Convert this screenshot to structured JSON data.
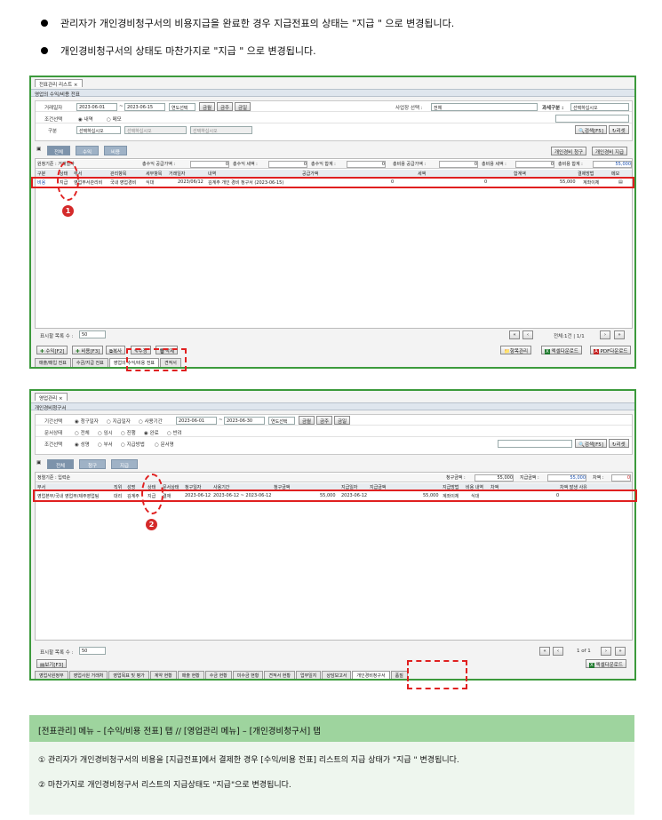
{
  "bullets": [
    "관리자가 개인경비청구서의 비용지급을 완료한 경우 지급전표의 상태는 \"지급 \" 으로 변경됩니다.",
    "개인경비청구서의 상태도 마찬가지로 \"지급 \" 으로 변경됩니다."
  ],
  "shot1": {
    "window_tab": "전표관리 리스트",
    "subtitle": "영업의 수익/비용 전표",
    "trade_date_label": "거래일자",
    "date_from": "2023-06-01",
    "date_to": "2023-06-15",
    "year_select": "연도선택",
    "quick_btns": [
      "금월",
      "금주",
      "금일"
    ],
    "biz_label": "사업장 선택 :",
    "biz_value": "전체",
    "tax_label": "과세구분 :",
    "tax_value": "선택하십시오",
    "cond_label": "조건선택",
    "cond_radio": [
      "내역",
      "메모"
    ],
    "kind_label": "구분",
    "kind_values": [
      "선택하십시오",
      "선택하십시오",
      "선택하십시오"
    ],
    "search_btn": "검색[F5]",
    "reset_btn": "리셋",
    "tabs": [
      "전체",
      "수익",
      "비용"
    ],
    "right_btns": [
      "개인경비 청구",
      "개인경비 지급"
    ],
    "summary": {
      "base": "원청기준 : 거래일자",
      "income_supply": "총수익 공급가액 :",
      "income_supply_val": "0",
      "income_tax": "총수익 세액 :",
      "income_tax_val": "0",
      "income_total": "총수익 합계 :",
      "income_total_val": "0",
      "cost_supply": "총비용 공급가액 :",
      "cost_supply_val": "0",
      "cost_tax": "총비용 세액 :",
      "cost_tax_val": "0",
      "cost_total": "총비용 합계 :",
      "cost_total_val": "55,000"
    },
    "columns": [
      "구분",
      "상태",
      "부서",
      "관리항목",
      "세부항목",
      "거래일자",
      "내역",
      "공급가액",
      "세액",
      "합계액",
      "결제방법",
      "메모"
    ],
    "row": [
      "비용",
      "지급",
      "영업부서관리비",
      "국내 영업경비",
      "식대",
      "2023/06/12",
      "김계주 개인 경비 청구서 (2023-06-15)",
      "",
      "0",
      "0",
      "55,000",
      "계좌이체"
    ],
    "page_size_label": "표시할 목록 수 :",
    "page_size": "50",
    "page_info": "전체:1건 | 1/1",
    "bottom_btns": [
      "수익[F2]",
      "비용[F3]",
      "복사",
      "수정",
      "삭제"
    ],
    "bottom_right": [
      "항목관리",
      "엑셀다운로드",
      "PDF다운로드"
    ],
    "bottom_tabs": [
      "매출/매입 전표",
      "수금/지급 전표",
      "영업의 수익/비용 전표",
      "견적서"
    ]
  },
  "shot2": {
    "window_tab": "영업관리",
    "subtitle": "개인경비청구서",
    "period_label": "기간선택",
    "period_radio": [
      "청구일자",
      "지급일자",
      "사용기간"
    ],
    "date_from": "2023-06-01",
    "date_to": "2023-06-30",
    "year_select": "연도선택",
    "quick_btns": [
      "금월",
      "금주",
      "금일"
    ],
    "doc_label": "문서상태",
    "doc_radio": [
      "전체",
      "임시",
      "진행",
      "완료",
      "반려"
    ],
    "cond_label": "조건선택",
    "cond_radio": [
      "성명",
      "부서",
      "지급방법",
      "문서명"
    ],
    "search_btn": "검색[F5]",
    "reset_btn": "리셋",
    "tabs": [
      "전체",
      "청구",
      "지급"
    ],
    "sort_label": "정렬기준 : 입력순",
    "claim_label": "청구금액 :",
    "claim_val": "55,000",
    "paid_label": "지급금액 :",
    "paid_val": "55,000",
    "diff_label": "차액 :",
    "diff_val": "0",
    "columns": [
      "부서",
      "직위",
      "성명",
      "상태",
      "문서상태",
      "청구일자",
      "사용기간",
      "청구금액",
      "지급일자",
      "지급금액",
      "지급방법",
      "비용 내역",
      "차액",
      "차액 발생 사유"
    ],
    "row": [
      "영업본부/국내 영업부/제주영업팀",
      "대리",
      "김계주",
      "지급",
      "결재",
      "2023-06-12",
      "2023-06-12 ~ 2023-06-12",
      "55,000",
      "2023-06-12",
      "55,000",
      "계좌이체",
      "식대",
      "0",
      ""
    ],
    "page_size_label": "표시할 목록 수 :",
    "page_size": "50",
    "page_info": "1 of 1",
    "view_btn": "보기[F3]",
    "excel_btn": "엑셀다운로드",
    "bottom_tabs": [
      "영업사원정부",
      "영업사원 거래처",
      "영업목표 및 평가",
      "계약 현황",
      "매출 현황",
      "수금 현황",
      "미수금 현황",
      "견적서 현황",
      "업무일지",
      "상담보고서",
      "개인경비청구서",
      "품질"
    ]
  },
  "note": {
    "header": "[전표관리] 메뉴 – [수익/비용 전표] 탭 // [영업관리 메뉴] – [개인경비청구서] 탭",
    "line1": "① 관리자가 개인경비청구서의 비용을 [지급전표]에서 결제한 경우 [수익/비용 전표] 리스트의 지급 상태가 \"지급 \" 변경됩니다.",
    "line2": "② 마찬가지로 개인경비청구서 리스트의 지급상태도 \"지급\"으로 변경됩니다."
  },
  "markers": [
    "1",
    "2"
  ]
}
